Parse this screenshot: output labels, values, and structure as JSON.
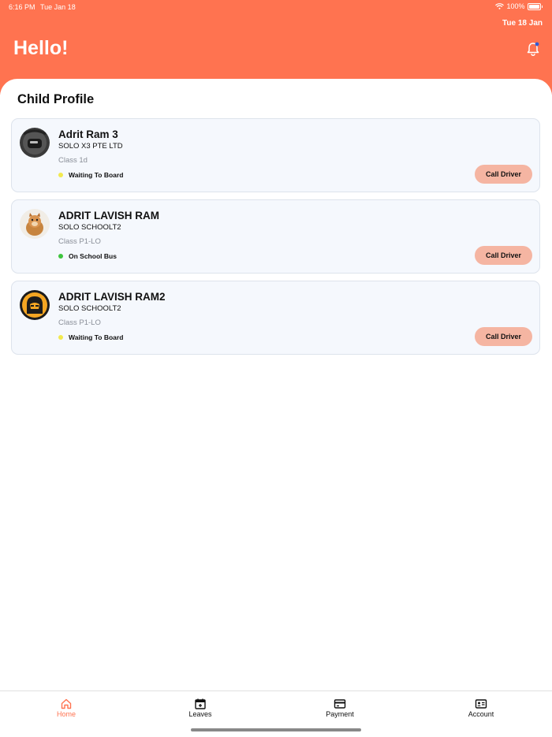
{
  "status_bar": {
    "time": "6:16 PM",
    "date": "Tue Jan 18",
    "battery": "100%"
  },
  "header": {
    "date": "Tue 18 Jan",
    "greeting": "Hello!",
    "accent_color": "#ff7350"
  },
  "section_title": "Child Profile",
  "children": [
    {
      "name": "Adrit Ram 3",
      "school": "SOLO X3 PTE LTD",
      "class": "Class 1d",
      "status": "Waiting To Board",
      "status_color": "#f2e94e",
      "button": "Call Driver"
    },
    {
      "name": "ADRIT LAVISH RAM",
      "school": "SOLO SCHOOLT2",
      "class": "Class P1-LO",
      "status": "On School Bus",
      "status_color": "#3ec43e",
      "button": "Call Driver"
    },
    {
      "name": "ADRIT LAVISH RAM2",
      "school": "SOLO SCHOOLT2",
      "class": "Class P1-LO",
      "status": "Waiting To Board",
      "status_color": "#f2e94e",
      "button": "Call Driver"
    }
  ],
  "tabs": [
    {
      "label": "Home",
      "icon": "home-icon",
      "active": true
    },
    {
      "label": "Leaves",
      "icon": "calendar-icon",
      "active": false
    },
    {
      "label": "Payment",
      "icon": "credit-card-icon",
      "active": false
    },
    {
      "label": "Account",
      "icon": "id-card-icon",
      "active": false
    }
  ]
}
